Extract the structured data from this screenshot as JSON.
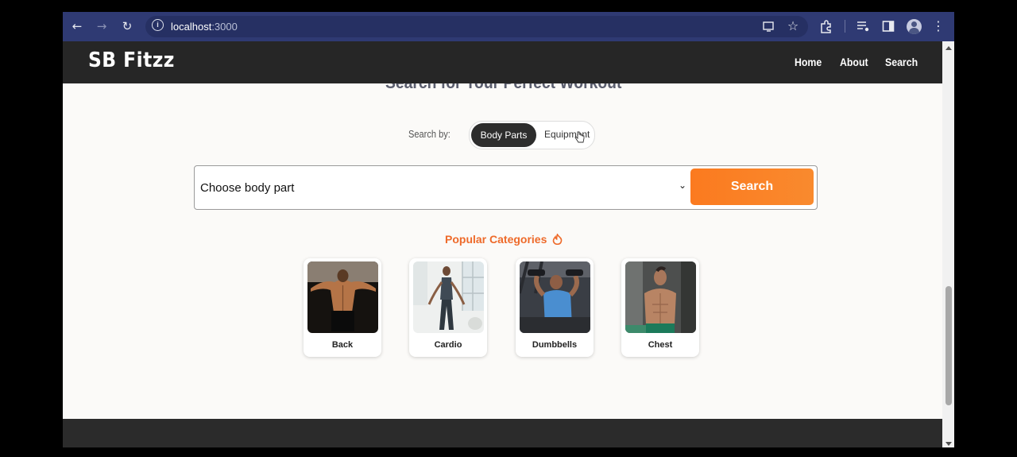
{
  "browser": {
    "url_host": "localhost",
    "url_port": ":3000",
    "back_icon": "arrow-left-icon",
    "forward_icon": "arrow-right-icon",
    "reload_icon": "reload-icon",
    "info_icon": "info-icon"
  },
  "navbar": {
    "brand": "SB Fitzz",
    "links": [
      "Home",
      "About",
      "Search"
    ]
  },
  "hero": {
    "heading": "Search for Your Perfect Workout"
  },
  "search": {
    "search_by_label": "Search by:",
    "toggle_options": [
      "Body Parts",
      "Equipment"
    ],
    "active_option": "Body Parts",
    "select_value": "Choose body part",
    "button_label": "Search"
  },
  "popular": {
    "title": "Popular Categories",
    "categories": [
      {
        "label": "Back"
      },
      {
        "label": "Cardio"
      },
      {
        "label": "Dumbbells"
      },
      {
        "label": "Chest"
      }
    ]
  },
  "colors": {
    "accent": "#fb7a1f",
    "navbar": "#262626",
    "browser_toolbar": "#2f3a73",
    "heading_accent": "#ee6a2a"
  }
}
